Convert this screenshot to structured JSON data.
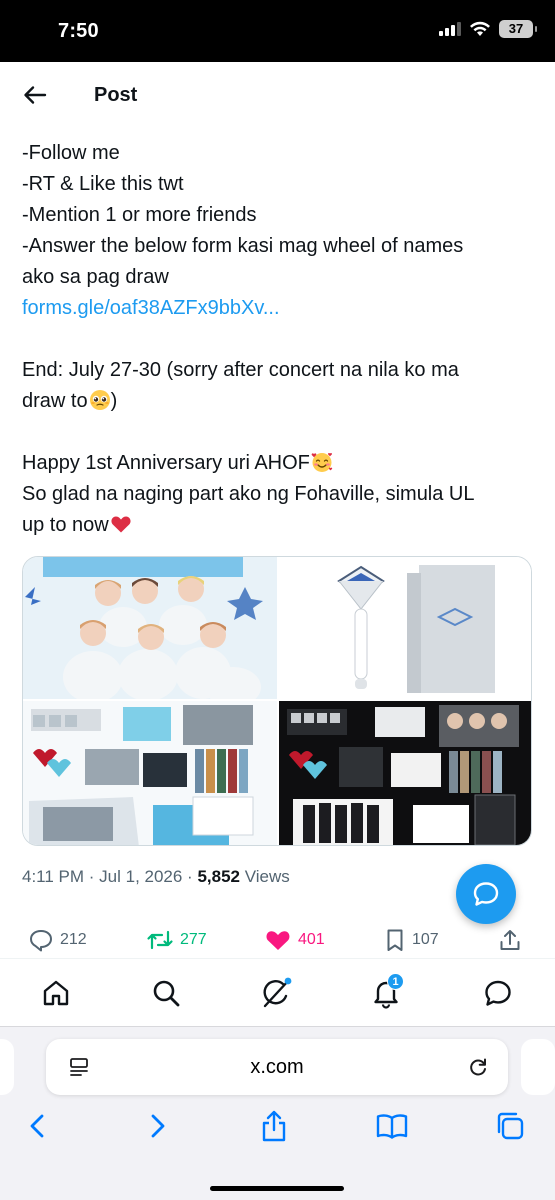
{
  "status_bar": {
    "time": "7:50",
    "battery": "37",
    "icons": [
      "cellular-signal-icon",
      "wifi-icon",
      "battery-icon"
    ]
  },
  "header": {
    "title": "Post",
    "back_icon": "arrow-left-icon"
  },
  "tweet": {
    "lines": [
      "-Follow me",
      "-RT & Like this twt",
      "-Mention 1 or more friends",
      "-Answer the below form kasi mag wheel of names",
      "ako sa pag draw"
    ],
    "link": "forms.gle/oaf38AZFx9bbXv...",
    "end_line_1": "End: July 27-30 (sorry after concert na nila ko ma",
    "end_line_2": "draw to",
    "end_emoji": "pleading-face-emoji",
    "anniversary_line": "Happy 1st Anniversary uri AHOF",
    "anniversary_emoji": "smiling-face-with-hearts-emoji",
    "glad_line_1": "So glad na naging part ako ng Fohaville, simula UL",
    "glad_line_2": "up to now",
    "heart_emoji": "red-heart-emoji"
  },
  "media": [
    {
      "name": "group-photo",
      "description_icon": "photo"
    },
    {
      "name": "lightstick-photo",
      "description_icon": "photo"
    },
    {
      "name": "album-version-white-photo",
      "description_icon": "photo"
    },
    {
      "name": "album-version-black-photo",
      "description_icon": "photo"
    }
  ],
  "meta": {
    "time_date": "4:11 PM · Jul 1, 2026 · ",
    "views_count": "5,852",
    "views_label": " Views"
  },
  "actions": {
    "replies": "212",
    "reposts": "277",
    "likes": "401",
    "bookmarks": "107"
  },
  "colors": {
    "accent": "#1d9bf0",
    "repost": "#00ba7c",
    "like": "#f91880",
    "muted": "#536471",
    "text": "#0f1419"
  },
  "tab_bar": {
    "notification_count": "1",
    "tabs": [
      "home-icon",
      "search-icon",
      "grok-icon",
      "bell-icon",
      "messages-icon"
    ]
  },
  "browser": {
    "url": "x.com"
  }
}
